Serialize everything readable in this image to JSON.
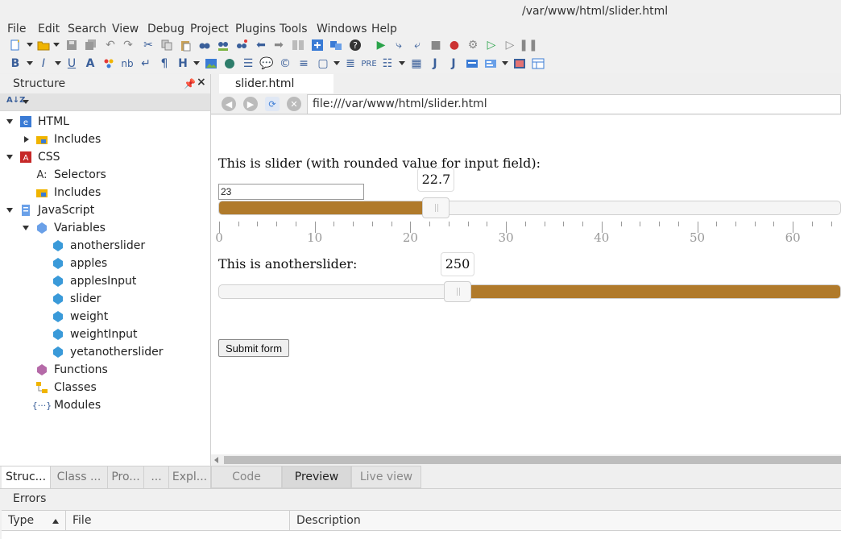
{
  "window": {
    "title": "/var/www/html/slider.html"
  },
  "menu": [
    "File",
    "Edit",
    "Search",
    "View",
    "Debug",
    "Project",
    "Plugins",
    "Tools",
    "Windows",
    "Help"
  ],
  "structure_panel": {
    "title": "Structure",
    "tree": [
      {
        "label": "HTML",
        "level": 0,
        "expanded": true,
        "icon": "html-icon"
      },
      {
        "label": "Includes",
        "level": 1,
        "expanded": false,
        "icon": "includes-icon"
      },
      {
        "label": "CSS",
        "level": 0,
        "expanded": true,
        "icon": "css-icon"
      },
      {
        "label": "Selectors",
        "level": 1,
        "icon": "selectors-icon"
      },
      {
        "label": "Includes",
        "level": 1,
        "icon": "includes-icon"
      },
      {
        "label": "JavaScript",
        "level": 0,
        "expanded": true,
        "icon": "javascript-icon"
      },
      {
        "label": "Variables",
        "level": 1,
        "expanded": true,
        "icon": "variables-icon"
      },
      {
        "label": "anotherslider",
        "level": 2,
        "icon": "variable-icon"
      },
      {
        "label": "apples",
        "level": 2,
        "icon": "variable-icon"
      },
      {
        "label": "applesInput",
        "level": 2,
        "icon": "variable-icon"
      },
      {
        "label": "slider",
        "level": 2,
        "icon": "variable-icon"
      },
      {
        "label": "weight",
        "level": 2,
        "icon": "variable-icon"
      },
      {
        "label": "weightInput",
        "level": 2,
        "icon": "variable-icon"
      },
      {
        "label": "yetanotherslider",
        "level": 2,
        "icon": "variable-icon"
      },
      {
        "label": "Functions",
        "level": 1,
        "icon": "functions-icon"
      },
      {
        "label": "Classes",
        "level": 1,
        "icon": "classes-icon"
      },
      {
        "label": "Modules",
        "level": 1,
        "icon": "modules-icon"
      }
    ]
  },
  "left_tabs": [
    "Struc...",
    "Class ...",
    "Pro...",
    "...",
    "Expl..."
  ],
  "editor": {
    "tab_label": "slider.html"
  },
  "nav": {
    "url": "file:///var/www/html/slider.html"
  },
  "preview": {
    "slider1_label": "This is slider (with rounded value for input field):",
    "slider1_input_value": "23",
    "slider1_tooltip": "22.7",
    "slider1_value": 22.7,
    "slider1_ticks": [
      "0",
      "10",
      "20",
      "30",
      "40",
      "50",
      "60"
    ],
    "slider2_label": "This is anotherslider:",
    "slider2_tooltip": "250",
    "slider2_value": 250,
    "submit_label": "Submit form"
  },
  "view_tabs": [
    "Code",
    "Preview",
    "Live view"
  ],
  "errors": {
    "title": "Errors",
    "columns": [
      "Type",
      "File",
      "Description"
    ]
  },
  "colors": {
    "slider_fill": "#b07a2b"
  }
}
